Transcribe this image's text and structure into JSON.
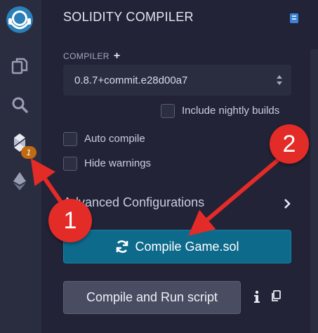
{
  "panel": {
    "title": "SOLIDITY COMPILER",
    "compiler_label": "COMPILER",
    "compiler_version": "0.8.7+commit.e28d00a7",
    "include_nightly_label": "Include nightly builds",
    "auto_compile_label": "Auto compile",
    "hide_warnings_label": "Hide warnings",
    "advanced_label": "Advanced Configurations",
    "compile_button_label": "Compile Game.sol",
    "run_script_button_label": "Compile and Run script",
    "info_label": "i"
  },
  "sidebar": {
    "compiler_badge": "1",
    "icons": [
      "remix-logo-icon",
      "file-explorer-icon",
      "search-icon",
      "solidity-compiler-icon",
      "deploy-run-icon"
    ]
  },
  "annotations": {
    "marker_1": "1",
    "marker_2": "2"
  },
  "colors": {
    "background": "#222336",
    "sidebar": "#2a2c3f",
    "compile_button": "#0d6a8b",
    "run_button": "#4a4d62",
    "badge": "#c06a12",
    "annotation_red": "#e32b27"
  }
}
